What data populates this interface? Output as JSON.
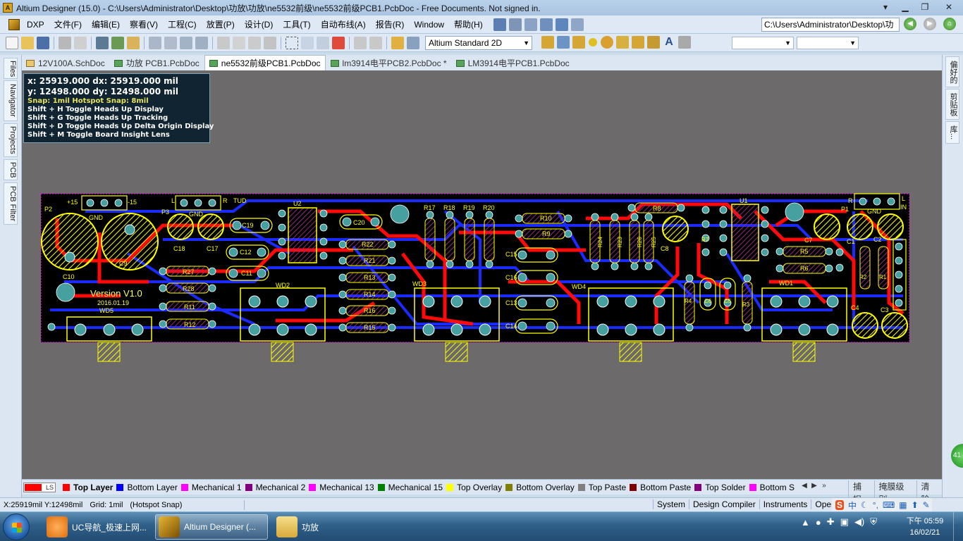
{
  "window": {
    "title": "Altium Designer (15.0) - C:\\Users\\Administrator\\Desktop\\功放\\功放\\ne5532前级\\ne5532前级PCB1.PcbDoc - Free Documents. Not signed in."
  },
  "menu": {
    "items": [
      "DXP",
      "文件(F)",
      "编辑(E)",
      "察看(V)",
      "工程(C)",
      "放置(P)",
      "设计(D)",
      "工具(T)",
      "自动布线(A)",
      "报告(R)",
      "Window",
      "帮助(H)"
    ],
    "path": "C:\\Users\\Administrator\\Desktop\\功"
  },
  "toolbar": {
    "view_mode": "Altium Standard 2D"
  },
  "left_panels": [
    "Files",
    "Navigator",
    "Projects",
    "PCB",
    "PCB Filter"
  ],
  "right_panels": [
    "偏好的",
    "剪贴板",
    "库..."
  ],
  "right_badge": "41",
  "doc_tabs": [
    {
      "label": "12V100A.SchDoc",
      "kind": "sch"
    },
    {
      "label": "功放 PCB1.PcbDoc",
      "kind": "pcb"
    },
    {
      "label": "ne5532前级PCB1.PcbDoc",
      "kind": "pcb",
      "active": true
    },
    {
      "label": "lm3914电平PCB2.PcbDoc *",
      "kind": "pcb"
    },
    {
      "label": "LM3914电平PCB1.PcbDoc",
      "kind": "pcb"
    }
  ],
  "hud": {
    "line1": "x: 25919.000   dx: 25919.000 mil",
    "line2": "y: 12498.000   dy: 12498.000  mil",
    "snap": "Snap: 1mil Hotspot Snap: 8mil",
    "hints": [
      "Shift + H   Toggle Heads Up Display",
      "Shift + G   Toggle Heads Up Tracking",
      "Shift + D   Toggle Heads Up Delta Origin Display",
      "Shift + M  Toggle Board Insight Lens"
    ]
  },
  "board": {
    "version_text": "Version V1.0",
    "date_text": "2016.01.19",
    "labels": {
      "p2": "P2",
      "p15": "+15",
      "m15": "-15",
      "gnd": "GND",
      "c10": "C10",
      "c9": "C9",
      "wd5": "WD5",
      "l1": "L",
      "r1": "R",
      "tud": "TUD",
      "p3": "P3",
      "gnd2": "GND",
      "c18": "C18",
      "c17": "C17",
      "r27": "R27",
      "r28": "R28",
      "r11": "R11",
      "r12": "R12",
      "c19": "C19",
      "c12": "C12",
      "c11": "C11",
      "wd2": "WD2",
      "u2": "U2",
      "c20": "C20",
      "r22": "R22",
      "r21": "R21",
      "r13": "R13",
      "r14": "R14",
      "r16": "R16",
      "r15": "R15",
      "wd3": "WD3",
      "r17": "R17",
      "r18": "R18",
      "r19": "R19",
      "r20": "R20",
      "r10": "R10",
      "r9": "R9",
      "c15": "C15",
      "c16": "C16",
      "c13": "C13",
      "c14": "C14",
      "wd4": "WD4",
      "r24": "R24",
      "r23": "R23",
      "r26": "R26",
      "r25": "R25",
      "r8": "R8",
      "c8": "C8",
      "r7": "R7",
      "r4": "R4",
      "c6": "C6",
      "c5": "C5",
      "r3": "R3",
      "u1": "U1",
      "c7": "C7",
      "r5": "R5",
      "r6": "R6",
      "wd1": "WD1",
      "p1": "P1",
      "r_right": "R",
      "l_right": "L",
      "in": "IN",
      "gnd3": "GND",
      "c1": "C1",
      "c2": "C2",
      "r2": "R2",
      "r1b": "R1",
      "c4": "C4",
      "c3": "C3"
    }
  },
  "layers": {
    "ls_label": "LS",
    "items": [
      {
        "name": "Top Layer",
        "color": "#ff0000",
        "active": true
      },
      {
        "name": "Bottom Layer",
        "color": "#0000ff"
      },
      {
        "name": "Mechanical 1",
        "color": "#ff00ff"
      },
      {
        "name": "Mechanical 2",
        "color": "#800080"
      },
      {
        "name": "Mechanical 13",
        "color": "#ff00ff"
      },
      {
        "name": "Mechanical 15",
        "color": "#008000"
      },
      {
        "name": "Top Overlay",
        "color": "#ffff00"
      },
      {
        "name": "Bottom Overlay",
        "color": "#808000"
      },
      {
        "name": "Top Paste",
        "color": "#808080"
      },
      {
        "name": "Bottom Paste",
        "color": "#800000"
      },
      {
        "name": "Top Solder",
        "color": "#800080"
      },
      {
        "name": "Bottom S",
        "color": "#ff00ff"
      }
    ],
    "buttons": [
      "捕捉",
      "掩膜级别",
      "清除"
    ]
  },
  "status": {
    "coords": "X:25919mil Y:12498mil",
    "grid": "Grid: 1mil",
    "snap": "(Hotspot Snap)",
    "panels": [
      "System",
      "Design Compiler",
      "Instruments",
      "Open"
    ]
  },
  "ime": {
    "logo": "S",
    "lang": "中"
  },
  "taskbar": {
    "tasks": [
      "UC导航_极速上网...",
      "Altium Designer (...",
      "功放"
    ],
    "time": "下午 05:59",
    "date": "16/02/21"
  },
  "colors": {
    "board_bg": "#000000",
    "top_layer": "#ff0000",
    "bottom_layer": "#0000ff",
    "overlay": "#ffff00",
    "pad": "#46a0a0",
    "canvas": "#6d6a6b"
  }
}
